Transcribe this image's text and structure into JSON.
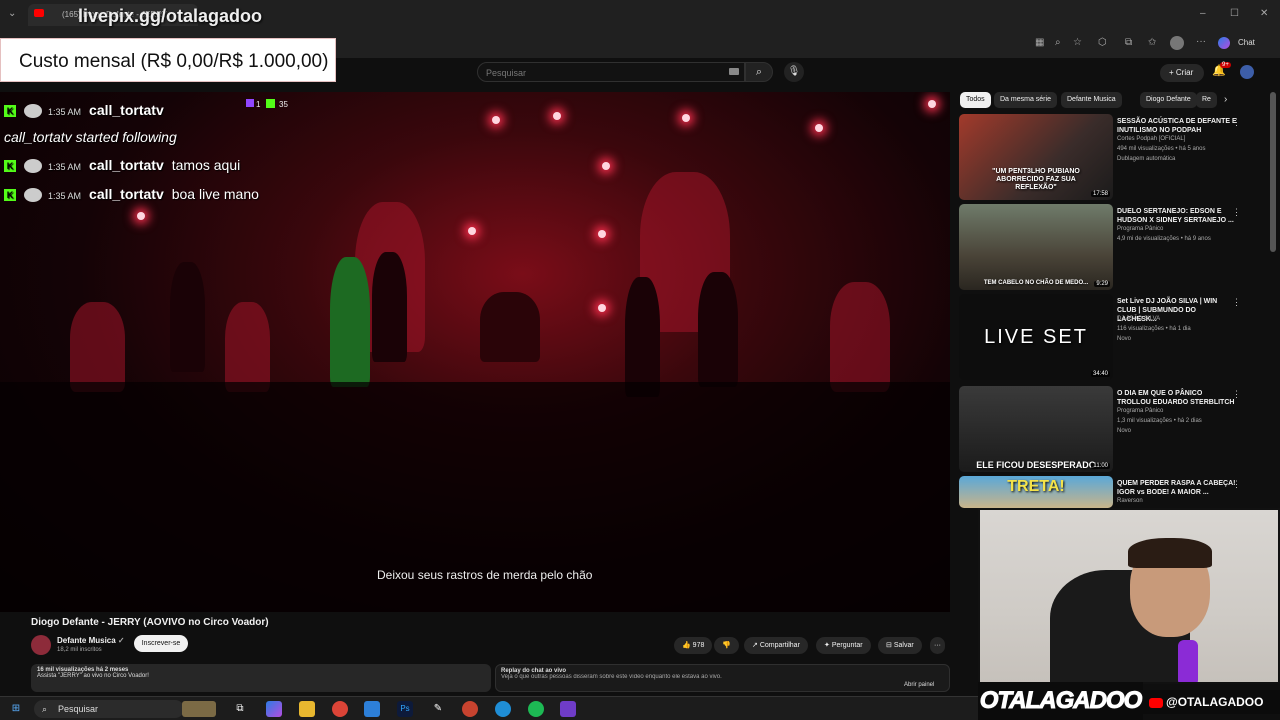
{
  "overlay": {
    "livepix": "livepix.gg/otalagadoo",
    "custo": "Custo mensal (R$ 0,00/R$ 1.000,00)"
  },
  "browser": {
    "tab_title": "(165) Diogo Defante - JERRY",
    "chat_label": "Chat"
  },
  "header": {
    "search_placeholder": "Pesquisar",
    "create_label": "Criar",
    "notif_count": "9+"
  },
  "chat": {
    "badge_count_1": "1",
    "badge_count_2": "35",
    "rows": [
      {
        "time": "1:35 AM",
        "user": "call_tortatv",
        "msg": ""
      },
      {
        "text": "call_tortatv started following"
      },
      {
        "time": "1:35 AM",
        "user": "call_tortatv",
        "msg": "tamos aqui"
      },
      {
        "time": "1:35 AM",
        "user": "call_tortatv",
        "msg": "boa live mano"
      }
    ]
  },
  "video": {
    "subtitle": "Deixou seus rastros de merda pelo chão"
  },
  "meta": {
    "title": "Diogo Defante - JERRY (AOVIVO no Circo Voador)",
    "channel": "Defante Musica",
    "subs": "18,2 mil inscritos",
    "subscribe": "Inscrever-se",
    "likes": "978",
    "share": "Compartilhar",
    "ask": "Perguntar",
    "save": "Salvar",
    "desc_line1": "16 mil visualizações  há 2 meses",
    "desc_line2": "Assista \"JERRY\" ao vivo no Circo Voador!",
    "replay_title": "Replay do chat ao vivo",
    "replay_text": "Veja o que outras pessoas disseram sobre este vídeo enquanto ele estava ao vivo.",
    "replay_open": "Abrir painel"
  },
  "chips": [
    "Todos",
    "Da mesma série",
    "Defante Musica",
    "Diogo Defante",
    "Re"
  ],
  "recs": [
    {
      "title": "SESSÃO ACÚSTICA DE DEFANTE E INUTILISMO NO PODPAH",
      "channel": "Cortes Podpah [OFICIAL]",
      "meta": "494 mil visualizações • há 5 anos",
      "extra": "Dublagem automática",
      "duration": "17:58",
      "thumb_text": "\"UM PENT3LHO PUBIANO ABORRECIDO FAZ SUA REFLEXÃO\""
    },
    {
      "title": "DUELO SERTANEJO: EDSON E HUDSON X SIDNEY SERTANEJO ...",
      "channel": "Programa Pânico",
      "meta": "4,9 mi de visualizações • há 9 anos",
      "extra": "",
      "duration": "9:29",
      "thumb_text": "TEM CABELO NO CHÃO DE MEDO..."
    },
    {
      "title": "Set Live DJ JOÃO SILVA | WIN CLUB | SUBMUNDO DO LACHESK...",
      "channel": "DJ JOÃO SILVA",
      "meta": "116 visualizações • há 1 dia",
      "extra": "Novo",
      "duration": "34:40",
      "thumb_text": "LIVE SET"
    },
    {
      "title": "O DIA EM QUE O PÂNICO TROLLOU EDUARDO STERBLITCH",
      "channel": "Programa Pânico",
      "meta": "1,3 mil visualizações • há 2 dias",
      "extra": "Novo",
      "duration": "11:00",
      "thumb_text": "ELE FICOU DESESPERADO"
    },
    {
      "title": "QUEM PERDER RASPA A CABEÇA! IGOR vs BODE! A MAIOR ...",
      "channel": "Raverson",
      "meta": "",
      "extra": "",
      "duration": "",
      "thumb_text": "TRETA!"
    }
  ],
  "brand": {
    "left": "OTALAGADOO",
    "right": "@OTALAGADOO"
  },
  "taskbar": {
    "search": "Pesquisar"
  }
}
